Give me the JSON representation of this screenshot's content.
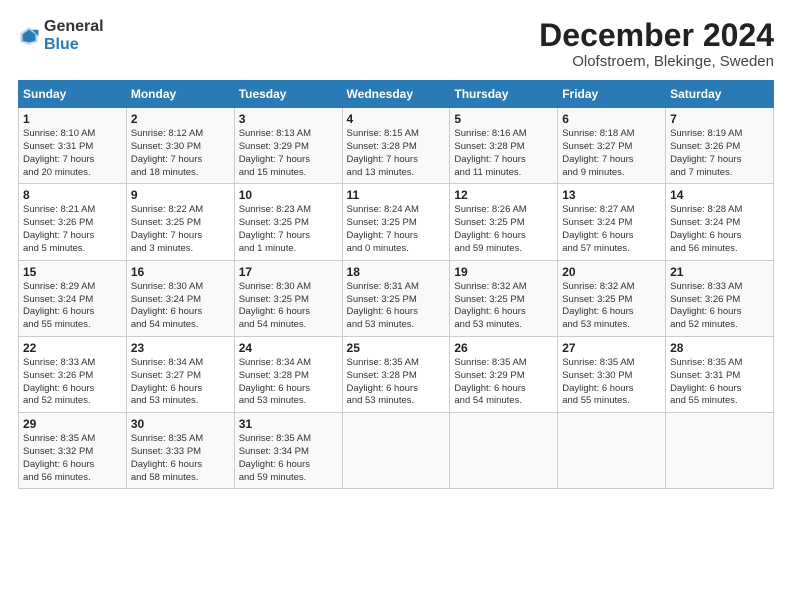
{
  "logo": {
    "text1": "General",
    "text2": "Blue"
  },
  "title": "December 2024",
  "subtitle": "Olofstroem, Blekinge, Sweden",
  "days_of_week": [
    "Sunday",
    "Monday",
    "Tuesday",
    "Wednesday",
    "Thursday",
    "Friday",
    "Saturday"
  ],
  "weeks": [
    [
      {
        "day": "1",
        "info": "Sunrise: 8:10 AM\nSunset: 3:31 PM\nDaylight: 7 hours\nand 20 minutes."
      },
      {
        "day": "2",
        "info": "Sunrise: 8:12 AM\nSunset: 3:30 PM\nDaylight: 7 hours\nand 18 minutes."
      },
      {
        "day": "3",
        "info": "Sunrise: 8:13 AM\nSunset: 3:29 PM\nDaylight: 7 hours\nand 15 minutes."
      },
      {
        "day": "4",
        "info": "Sunrise: 8:15 AM\nSunset: 3:28 PM\nDaylight: 7 hours\nand 13 minutes."
      },
      {
        "day": "5",
        "info": "Sunrise: 8:16 AM\nSunset: 3:28 PM\nDaylight: 7 hours\nand 11 minutes."
      },
      {
        "day": "6",
        "info": "Sunrise: 8:18 AM\nSunset: 3:27 PM\nDaylight: 7 hours\nand 9 minutes."
      },
      {
        "day": "7",
        "info": "Sunrise: 8:19 AM\nSunset: 3:26 PM\nDaylight: 7 hours\nand 7 minutes."
      }
    ],
    [
      {
        "day": "8",
        "info": "Sunrise: 8:21 AM\nSunset: 3:26 PM\nDaylight: 7 hours\nand 5 minutes."
      },
      {
        "day": "9",
        "info": "Sunrise: 8:22 AM\nSunset: 3:25 PM\nDaylight: 7 hours\nand 3 minutes."
      },
      {
        "day": "10",
        "info": "Sunrise: 8:23 AM\nSunset: 3:25 PM\nDaylight: 7 hours\nand 1 minute."
      },
      {
        "day": "11",
        "info": "Sunrise: 8:24 AM\nSunset: 3:25 PM\nDaylight: 7 hours\nand 0 minutes."
      },
      {
        "day": "12",
        "info": "Sunrise: 8:26 AM\nSunset: 3:25 PM\nDaylight: 6 hours\nand 59 minutes."
      },
      {
        "day": "13",
        "info": "Sunrise: 8:27 AM\nSunset: 3:24 PM\nDaylight: 6 hours\nand 57 minutes."
      },
      {
        "day": "14",
        "info": "Sunrise: 8:28 AM\nSunset: 3:24 PM\nDaylight: 6 hours\nand 56 minutes."
      }
    ],
    [
      {
        "day": "15",
        "info": "Sunrise: 8:29 AM\nSunset: 3:24 PM\nDaylight: 6 hours\nand 55 minutes."
      },
      {
        "day": "16",
        "info": "Sunrise: 8:30 AM\nSunset: 3:24 PM\nDaylight: 6 hours\nand 54 minutes."
      },
      {
        "day": "17",
        "info": "Sunrise: 8:30 AM\nSunset: 3:25 PM\nDaylight: 6 hours\nand 54 minutes."
      },
      {
        "day": "18",
        "info": "Sunrise: 8:31 AM\nSunset: 3:25 PM\nDaylight: 6 hours\nand 53 minutes."
      },
      {
        "day": "19",
        "info": "Sunrise: 8:32 AM\nSunset: 3:25 PM\nDaylight: 6 hours\nand 53 minutes."
      },
      {
        "day": "20",
        "info": "Sunrise: 8:32 AM\nSunset: 3:25 PM\nDaylight: 6 hours\nand 53 minutes."
      },
      {
        "day": "21",
        "info": "Sunrise: 8:33 AM\nSunset: 3:26 PM\nDaylight: 6 hours\nand 52 minutes."
      }
    ],
    [
      {
        "day": "22",
        "info": "Sunrise: 8:33 AM\nSunset: 3:26 PM\nDaylight: 6 hours\nand 52 minutes."
      },
      {
        "day": "23",
        "info": "Sunrise: 8:34 AM\nSunset: 3:27 PM\nDaylight: 6 hours\nand 53 minutes."
      },
      {
        "day": "24",
        "info": "Sunrise: 8:34 AM\nSunset: 3:28 PM\nDaylight: 6 hours\nand 53 minutes."
      },
      {
        "day": "25",
        "info": "Sunrise: 8:35 AM\nSunset: 3:28 PM\nDaylight: 6 hours\nand 53 minutes."
      },
      {
        "day": "26",
        "info": "Sunrise: 8:35 AM\nSunset: 3:29 PM\nDaylight: 6 hours\nand 54 minutes."
      },
      {
        "day": "27",
        "info": "Sunrise: 8:35 AM\nSunset: 3:30 PM\nDaylight: 6 hours\nand 55 minutes."
      },
      {
        "day": "28",
        "info": "Sunrise: 8:35 AM\nSunset: 3:31 PM\nDaylight: 6 hours\nand 55 minutes."
      }
    ],
    [
      {
        "day": "29",
        "info": "Sunrise: 8:35 AM\nSunset: 3:32 PM\nDaylight: 6 hours\nand 56 minutes."
      },
      {
        "day": "30",
        "info": "Sunrise: 8:35 AM\nSunset: 3:33 PM\nDaylight: 6 hours\nand 58 minutes."
      },
      {
        "day": "31",
        "info": "Sunrise: 8:35 AM\nSunset: 3:34 PM\nDaylight: 6 hours\nand 59 minutes."
      },
      {
        "day": "",
        "info": ""
      },
      {
        "day": "",
        "info": ""
      },
      {
        "day": "",
        "info": ""
      },
      {
        "day": "",
        "info": ""
      }
    ]
  ]
}
